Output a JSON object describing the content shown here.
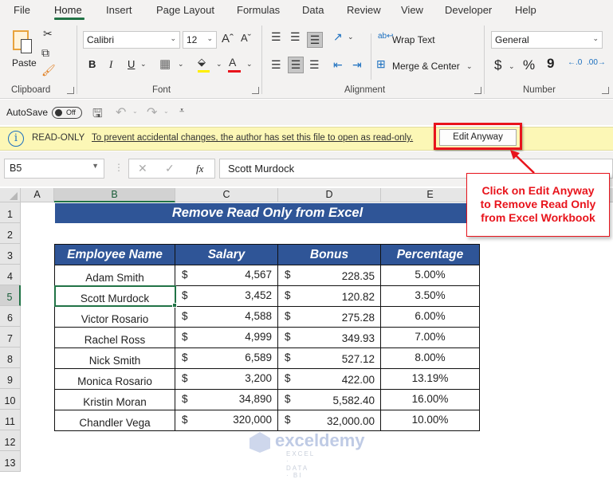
{
  "ribbon": {
    "tabs": [
      "File",
      "Home",
      "Insert",
      "Page Layout",
      "Formulas",
      "Data",
      "Review",
      "View",
      "Developer",
      "Help"
    ],
    "active_tab": "Home",
    "clipboard": {
      "paste_label": "Paste",
      "group_label": "Clipboard"
    },
    "font": {
      "font_name": "Calibri",
      "font_size": "12",
      "bold": "B",
      "italic": "I",
      "underline": "U",
      "group_label": "Font"
    },
    "alignment": {
      "wrap_text": "Wrap Text",
      "merge_center": "Merge & Center",
      "group_label": "Alignment"
    },
    "number": {
      "format": "General",
      "currency": "$",
      "percent": "%",
      "comma": "9",
      "group_label": "Number"
    }
  },
  "qat": {
    "autosave_label": "AutoSave",
    "autosave_state": "Off"
  },
  "message_bar": {
    "title": "READ-ONLY",
    "message": "To prevent accidental changes, the author has set this file to open as read-only.",
    "button_label": "Edit Anyway"
  },
  "formula_bar": {
    "name_box": "B5",
    "cancel": "✕",
    "enter": "✓",
    "fx": "fx",
    "value": "Scott Murdock"
  },
  "grid": {
    "columns": [
      "A",
      "B",
      "C",
      "D",
      "E"
    ],
    "rows": [
      "1",
      "2",
      "3",
      "4",
      "5",
      "6",
      "7",
      "8",
      "9",
      "10",
      "11",
      "12",
      "13"
    ],
    "selected_cell": "B5"
  },
  "sheet": {
    "title": "Remove Read Only from Excel",
    "headers": [
      "Employee Name",
      "Salary",
      "Bonus",
      "Percentage"
    ],
    "currency_symbol": "$",
    "rows": [
      {
        "name": "Adam Smith",
        "salary": "4,567",
        "bonus": "228.35",
        "pct": "5.00%"
      },
      {
        "name": "Scott Murdock",
        "salary": "3,452",
        "bonus": "120.82",
        "pct": "3.50%"
      },
      {
        "name": "Victor Rosario",
        "salary": "4,588",
        "bonus": "275.28",
        "pct": "6.00%"
      },
      {
        "name": "Rachel Ross",
        "salary": "4,999",
        "bonus": "349.93",
        "pct": "7.00%"
      },
      {
        "name": "Nick Smith",
        "salary": "6,589",
        "bonus": "527.12",
        "pct": "8.00%"
      },
      {
        "name": "Monica Rosario",
        "salary": "3,200",
        "bonus": "422.00",
        "pct": "13.19%"
      },
      {
        "name": "Kristin Moran",
        "salary": "34,890",
        "bonus": "5,582.40",
        "pct": "16.00%"
      },
      {
        "name": "Chandler Vega",
        "salary": "320,000",
        "bonus": "32,000.00",
        "pct": "10.00%"
      }
    ]
  },
  "callout": {
    "lines": [
      "Click on Edit Anyway",
      "to Remove Read Only",
      "from Excel Workbook"
    ],
    "color": "#e8141c"
  },
  "watermark": {
    "brand": "exceldemy",
    "tagline": "EXCEL · DATA · BI"
  },
  "colors": {
    "accent": "#217346",
    "header_fill": "#2f5597",
    "message_bar": "#fcf7b6"
  }
}
